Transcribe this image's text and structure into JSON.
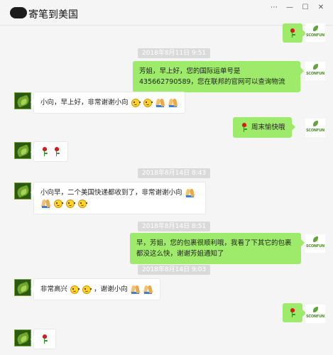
{
  "window": {
    "title": "寄笔到美国",
    "controls": [
      "⋯",
      "—",
      "☐",
      "✕"
    ]
  },
  "messages": {
    "m0_rose": "rose-emoji",
    "ts1": "2018年8月11日 9:51",
    "m1": "芳姐，早上好，您的国际运单号是435662790589，您在联邦的官网可以查询物流",
    "m2_text": "小向，早上好，非常谢谢小向",
    "m3_text": "周末愉快哦",
    "m4_emoji": "rose-emoji",
    "ts2": "2018年8月14日 8:43",
    "m5_text": "小向早，二个美国快递都收到了，非常谢谢小向",
    "ts3": "2018年8月14日 8:51",
    "m6": "早，芳姐，您的包裹很顺利哦，我看了下其它的包裹都没这么快，谢谢芳姐通知了",
    "ts4": "2018年8月14日 9:03",
    "m7_a": "非常高兴",
    "m7_b": "，谢谢小向",
    "m8_emoji": "rose-emoji",
    "m9_emoji": "rose-emoji"
  },
  "avatars": {
    "sender_brand": "SCONFUN",
    "receiver_icon": "leaf-avatar-icon"
  },
  "colors": {
    "sent_bubble": "#9eea6a",
    "received_bubble": "#ffffff",
    "chat_bg": "#f5f5f5",
    "timestamp_bg": "#dadada"
  }
}
